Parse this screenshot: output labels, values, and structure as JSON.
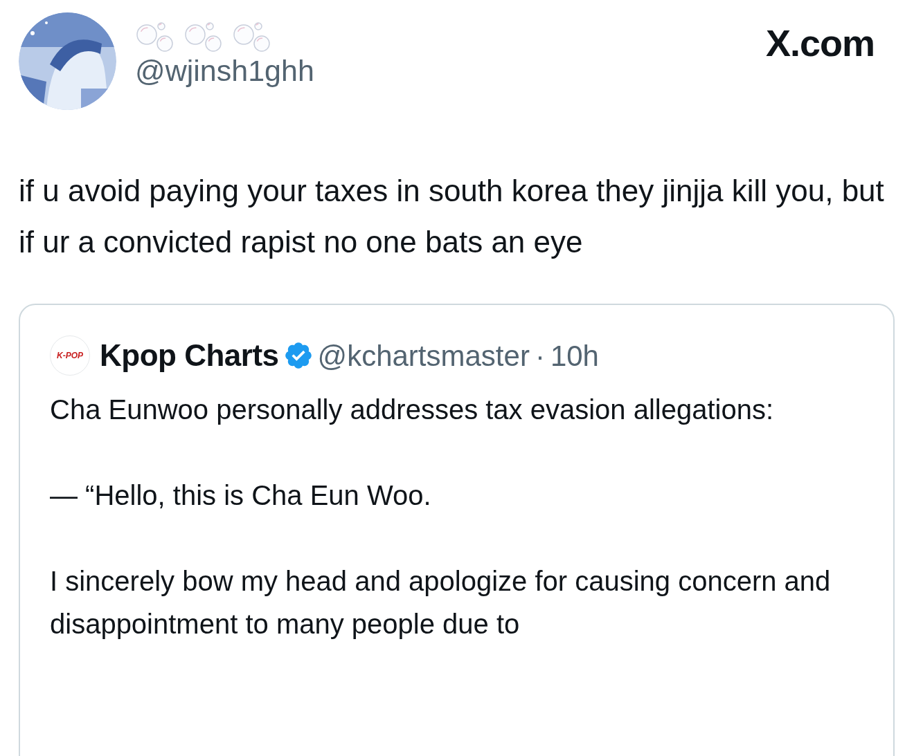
{
  "author": {
    "handle": "@wjinsh1ghh"
  },
  "site_label": "X.com",
  "tweet_text": "if u avoid paying your taxes in south korea they jinjja kill you, but if ur a convicted rapist no one bats an eye",
  "quoted_tweet": {
    "avatar_label": "K-POP",
    "name": "Kpop Charts",
    "verified": true,
    "handle": "@kchartsmaster",
    "separator": "·",
    "time": "10h",
    "paragraphs": [
      "Cha Eunwoo personally addresses tax evasion allegations:",
      "— “Hello, this is Cha Eun Woo.",
      "I sincerely bow my head and apologize for causing concern and disappointment to many people due to"
    ]
  }
}
